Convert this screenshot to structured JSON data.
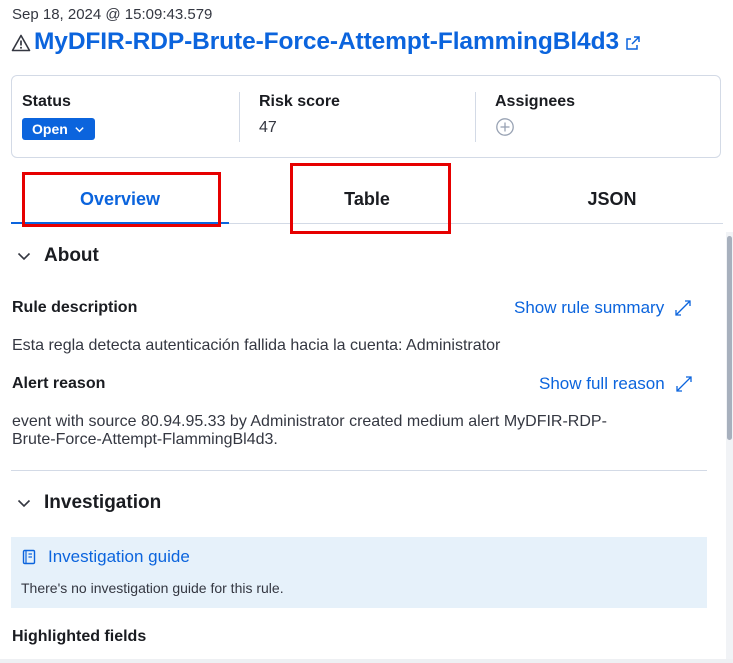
{
  "header": {
    "timestamp": "Sep 18, 2024 @ 15:09:43.579",
    "alert_title": "MyDFIR-RDP-Brute-Force-Attempt-FlammingBl4d3",
    "title_icon": "warning-icon",
    "external_icon": "popout-icon"
  },
  "summary": {
    "status_label": "Status",
    "status_value": "Open",
    "risk_label": "Risk score",
    "risk_value": "47",
    "assignees_label": "Assignees",
    "add_assignee_icon": "plus-circle-icon"
  },
  "tabs": [
    {
      "label": "Overview",
      "selected": true
    },
    {
      "label": "Table",
      "selected": false
    },
    {
      "label": "JSON",
      "selected": false
    }
  ],
  "about": {
    "title": "About",
    "rule_description_label": "Rule description",
    "show_rule_summary": "Show rule summary",
    "rule_description_text": "Esta regla detecta autenticación fallida hacia la cuenta: Administrator",
    "alert_reason_label": "Alert reason",
    "show_full_reason": "Show full reason",
    "alert_reason_line1": "event with source 80.94.95.33 by Administrator created medium alert MyDFIR-RDP-",
    "alert_reason_line2": "Brute-Force-Attempt-FlammingBl4d3."
  },
  "investigation": {
    "title": "Investigation",
    "guide_title": "Investigation guide",
    "guide_text": "There's no investigation guide for this rule.",
    "highlighted_fields_label": "Highlighted fields"
  },
  "colors": {
    "accent": "#0b64dd",
    "annotation_red": "#e60000",
    "callout_bg": "#e6f1fa"
  }
}
